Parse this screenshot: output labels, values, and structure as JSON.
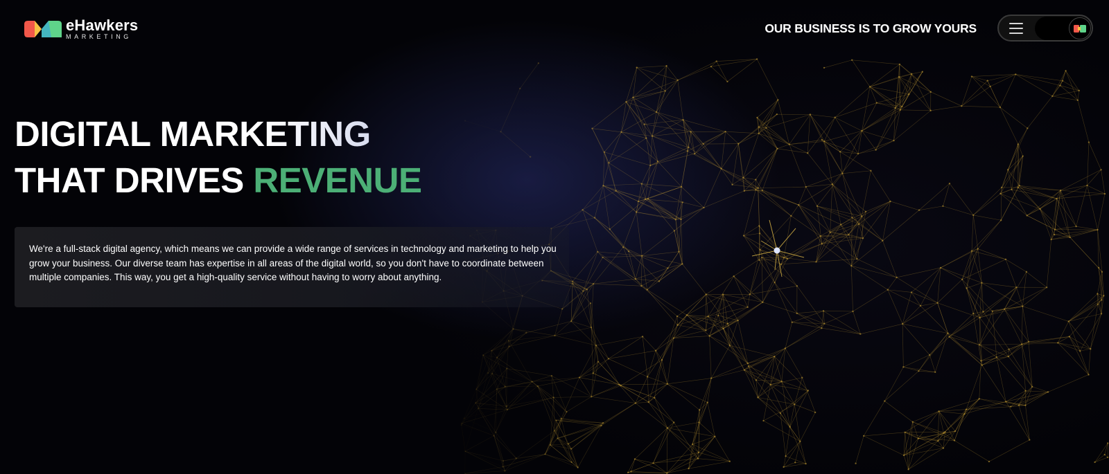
{
  "header": {
    "logo": {
      "name": "eHawkers",
      "subtitle": "MARKETING",
      "colors": [
        "#f2584a",
        "#f6c244",
        "#5fd48a",
        "#3fb0c9"
      ]
    },
    "tagline": "OUR BUSINESS IS TO GROW YOURS",
    "menu_icon": "hamburger-menu-icon",
    "theme_toggle_icon": "logo-badge-icon"
  },
  "hero": {
    "title_line1": "DIGITAL MARKETING",
    "title_line2_prefix": "THAT DRIVES",
    "title_line2_accent": "REVENUE",
    "description": "We're a full-stack digital agency, which means we can provide a wide range of services in technology and marketing to help you grow your business. Our diverse team has expertise in all areas of the digital world, so you don't have to coordinate between multiple companies. This way, you get a high-quality service without having to worry about anything."
  },
  "theme": {
    "background": "#030307",
    "accent_green": "#4caf76",
    "network_color": "#c8a035",
    "glow": "#282e6e"
  }
}
